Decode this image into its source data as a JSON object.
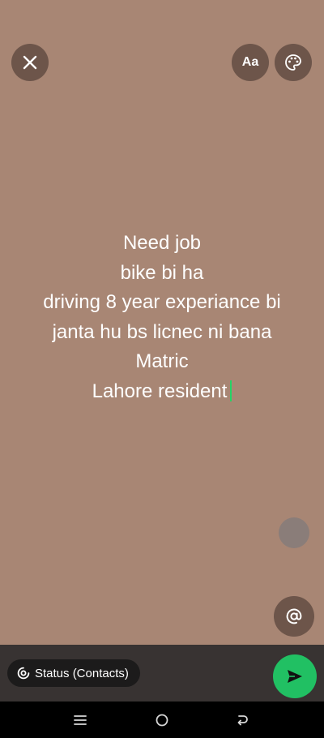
{
  "toolbar": {
    "close_icon": "close-icon",
    "font_label": "Aa",
    "palette_icon": "palette-icon"
  },
  "status": {
    "lines": [
      "Need job",
      "bike bi ha",
      "driving 8 year experiance  bi",
      "janta hu bs licnec ni bana",
      "Matric",
      "Lahore resident"
    ],
    "background_color": "#a88674",
    "cursor_color": "#25d366"
  },
  "mention_icon": "at-icon",
  "footer": {
    "audience_label": "Status (Contacts)",
    "audience_icon": "status-icon",
    "send_icon": "send-icon",
    "send_color": "#21c063"
  },
  "navigation": {
    "menu_icon": "recent-apps-icon",
    "home_icon": "home-icon",
    "back_icon": "back-icon"
  }
}
